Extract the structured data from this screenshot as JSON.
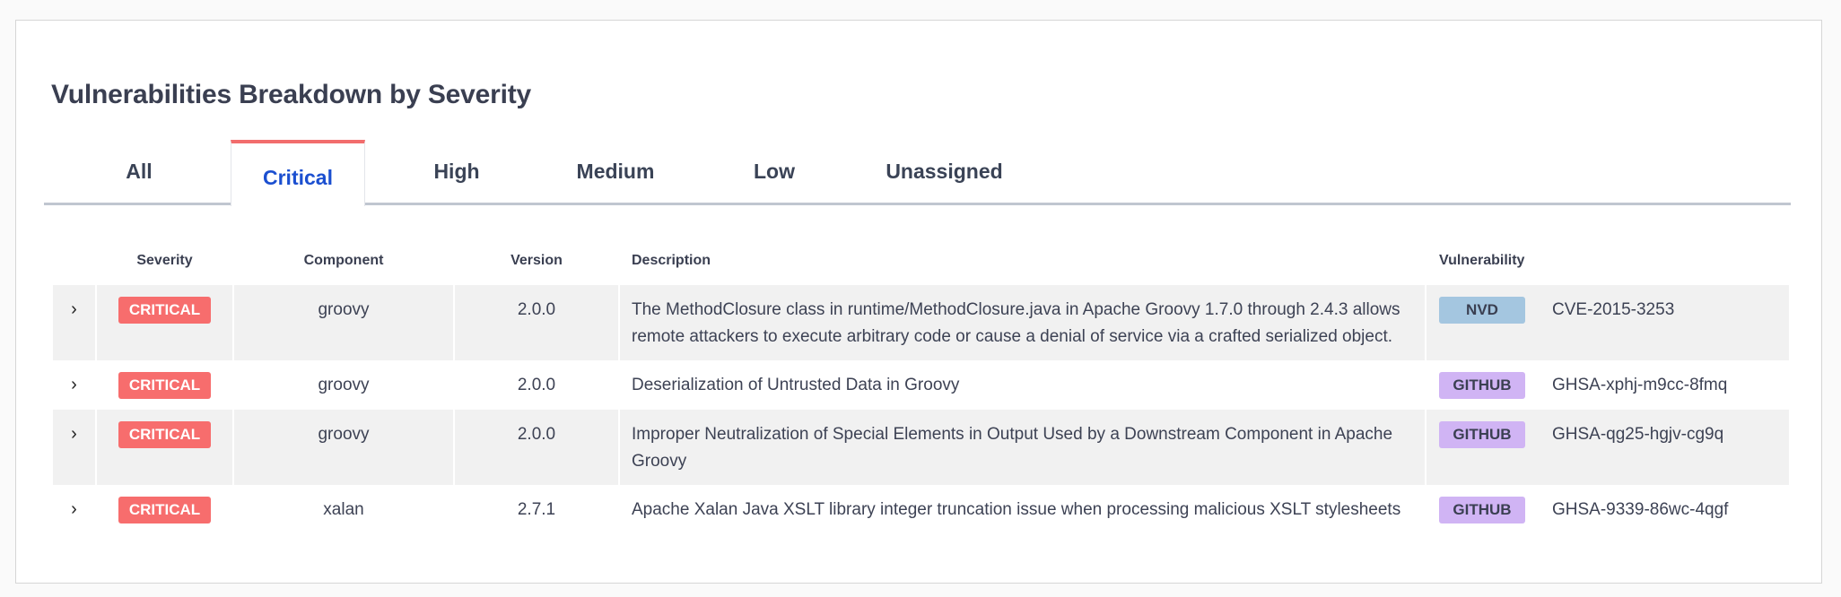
{
  "title": "Vulnerabilities Breakdown by Severity",
  "tabs": [
    {
      "label": "All",
      "active": false
    },
    {
      "label": "Critical",
      "active": true
    },
    {
      "label": "High",
      "active": false
    },
    {
      "label": "Medium",
      "active": false
    },
    {
      "label": "Low",
      "active": false
    },
    {
      "label": "Unassigned",
      "active": false
    }
  ],
  "columns": {
    "severity": "Severity",
    "component": "Component",
    "version": "Version",
    "description": "Description",
    "vulnerability": "Vulnerability"
  },
  "colors": {
    "critical": "#f76d6d",
    "nvd": "#a4c6e0",
    "github": "#d0b4f4",
    "active_tab": "#1b4fd0",
    "active_tab_border": "#f26d6d"
  },
  "rows": [
    {
      "severity": "CRITICAL",
      "component": "groovy",
      "version": "2.0.0",
      "description": "The MethodClosure class in runtime/MethodClosure.java in Apache Groovy 1.7.0 through 2.4.3 allows remote attackers to execute arbitrary code or cause a denial of service via a crafted serialized object.",
      "source": "NVD",
      "id": "CVE-2015-3253"
    },
    {
      "severity": "CRITICAL",
      "component": "groovy",
      "version": "2.0.0",
      "description": "Deserialization of Untrusted Data in Groovy",
      "source": "GITHUB",
      "id": "GHSA-xphj-m9cc-8fmq"
    },
    {
      "severity": "CRITICAL",
      "component": "groovy",
      "version": "2.0.0",
      "description": "Improper Neutralization of Special Elements in Output Used by a Downstream Component in Apache Groovy",
      "source": "GITHUB",
      "id": "GHSA-qg25-hgjv-cg9q"
    },
    {
      "severity": "CRITICAL",
      "component": "xalan",
      "version": "2.7.1",
      "description": "Apache Xalan Java XSLT library integer truncation issue when processing malicious XSLT stylesheets",
      "source": "GITHUB",
      "id": "GHSA-9339-86wc-4qgf"
    }
  ]
}
